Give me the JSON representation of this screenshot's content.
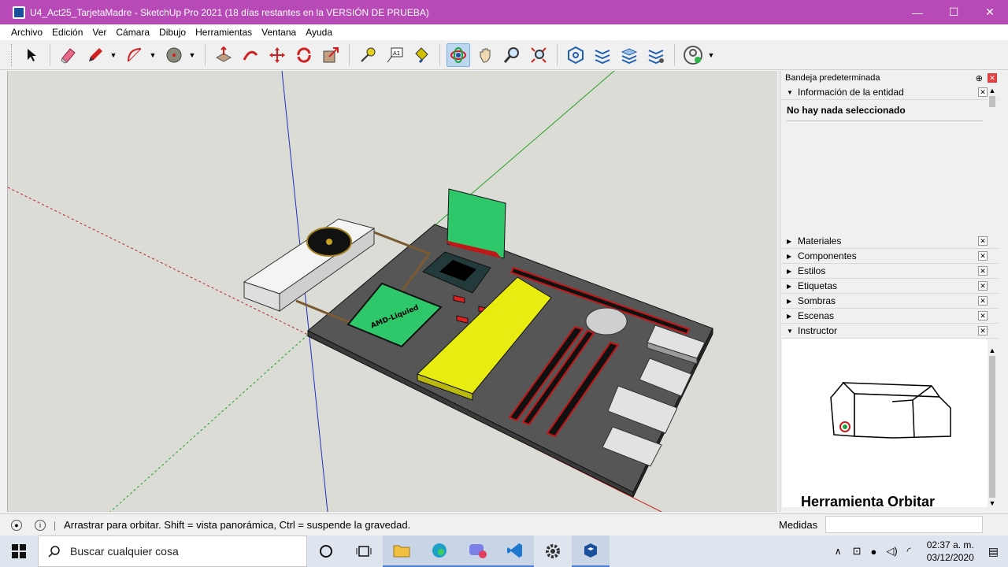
{
  "window": {
    "title": "U4_Act25_TarjetaMadre - SketchUp Pro 2021 (18 días restantes en la VERSIÓN DE PRUEBA)",
    "minimize": "—",
    "maximize": "☐",
    "close": "✕"
  },
  "menu": [
    "Archivo",
    "Edición",
    "Ver",
    "Cámara",
    "Dibujo",
    "Herramientas",
    "Ventana",
    "Ayuda"
  ],
  "toolbar": {
    "tools": [
      "select-tool",
      "eraser-tool",
      "pencil-tool",
      "arc-tool",
      "shapes-tool",
      "push-pull-tool",
      "follow-me-tool",
      "move-tool",
      "rotate-tool",
      "scale-tool",
      "tape-measure-tool",
      "text-tool",
      "paint-bucket-tool",
      "orbit-tool",
      "pan-tool",
      "zoom-tool",
      "zoom-extents-tool",
      "warehouse-tool",
      "extension-warehouse-tool",
      "layout-tool",
      "extension-manager-tool",
      "account-tool"
    ],
    "text_tool_label": "A1",
    "active": "orbit-tool"
  },
  "viewport": {
    "model_label": "AMD-Liquied"
  },
  "tray": {
    "title": "Bandeja predeterminada",
    "pin": "⊕",
    "close": "✕",
    "entity_info": {
      "label": "Información de la entidad",
      "status": "No hay nada seleccionado"
    },
    "panels": [
      "Materiales",
      "Componentes",
      "Estilos",
      "Etiquetas",
      "Sombras",
      "Escenas"
    ],
    "instructor": {
      "label": "Instructor",
      "heading": "Herramienta Orbitar"
    }
  },
  "status": {
    "message": "Arrastrar para orbitar. Shift = vista panorámica, Ctrl = suspende la gravedad.",
    "measurements_label": "Medidas",
    "measurements_value": ""
  },
  "taskbar": {
    "search_placeholder": "Buscar cualquier cosa",
    "time": "02:37 a. m.",
    "date": "03/12/2020",
    "apps": [
      "task-view-icon",
      "file-explorer-icon",
      "edge-icon",
      "discord-icon",
      "vscode-icon",
      "settings-icon",
      "sketchup-icon"
    ]
  },
  "colors": {
    "titlebar": "#b74ab7",
    "board": "#565656",
    "green": "#2ec76a",
    "yellow": "#e8ec10",
    "red": "#d62020",
    "active_tool": "#bcd7f0"
  }
}
